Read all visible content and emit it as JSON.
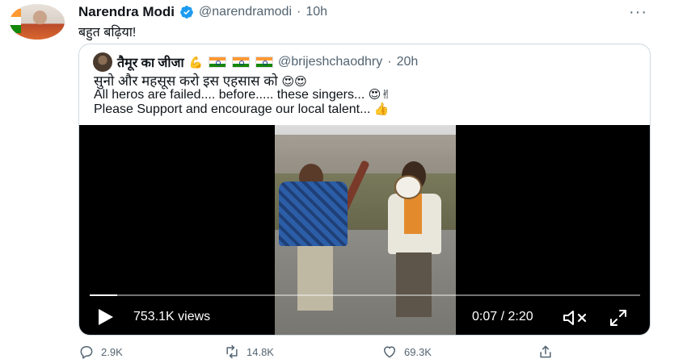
{
  "tweet": {
    "author_name": "Narendra Modi",
    "author_handle": "@narendramodi",
    "separator": "·",
    "time": "10h",
    "text": "बहुत बढ़िया!",
    "more_label": "···",
    "quote": {
      "author_name": "तैमूर का जीजा",
      "name_emoji": "💪",
      "author_handle": "@brijeshchaodhry",
      "separator": "·",
      "time": "20h",
      "line1": "सुनो और महसूस करो इस एहसास को",
      "line1_emoji": "😍😍",
      "line2": "All heros are failed....  before.....  these singers...",
      "line2_emoji": "😍✌",
      "line3": "Please Support and encourage our local talent...",
      "line3_emoji": "👍"
    },
    "video": {
      "views": "753.1K views",
      "time_readout": "0:07 / 2:20",
      "progress": 0.05
    },
    "actions": {
      "reply_count": "2.9K",
      "retweet_count": "14.8K",
      "like_count": "69.3K"
    }
  },
  "colors": {
    "verified": "#1d9bf0",
    "muted_text": "#536471",
    "border": "#cfd9de"
  },
  "icons": [
    "verified-badge-icon",
    "more-icon",
    "play-icon",
    "mute-icon",
    "fullscreen-icon",
    "reply-icon",
    "retweet-icon",
    "like-icon",
    "share-icon"
  ]
}
